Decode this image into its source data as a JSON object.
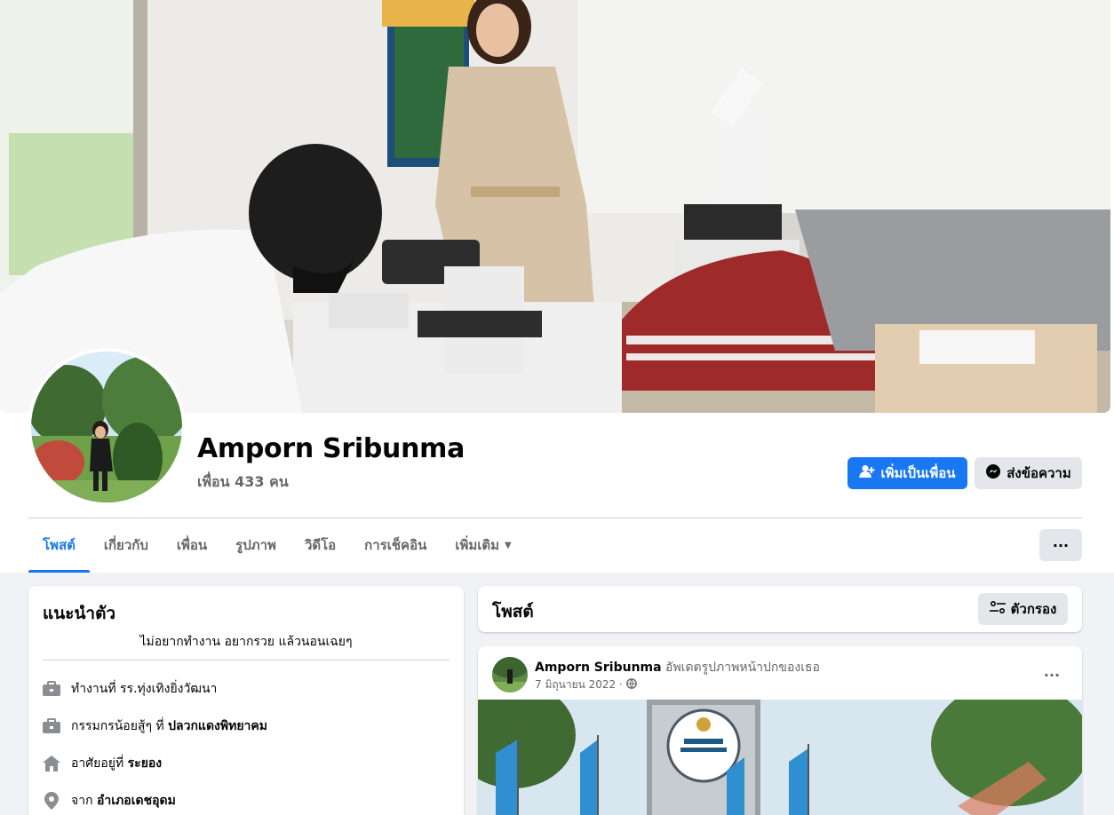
{
  "profile": {
    "name": "Amporn Sribunma",
    "friends": "เพื่อน 433 คน"
  },
  "actions": {
    "add_friend": "เพิ่มเป็นเพื่อน",
    "message": "ส่งข้อความ",
    "more": "···"
  },
  "tabs": [
    {
      "label": "โพสต์",
      "active": true
    },
    {
      "label": "เกี่ยวกับ"
    },
    {
      "label": "เพื่อน"
    },
    {
      "label": "รูปภาพ"
    },
    {
      "label": "วิดีโอ"
    },
    {
      "label": "การเช็คอิน"
    },
    {
      "label": "เพิ่มเติม"
    }
  ],
  "intro": {
    "title": "แนะนำตัว",
    "bio": "ไม่อยากทำงาน อยากรวย แล้วนอนเฉยๆ",
    "rows": [
      {
        "icon": "briefcase-icon",
        "prefix": "ทำงานที่ รร.ทุ่งเทิงยิ่งวัฒนา",
        "bold": ""
      },
      {
        "icon": "briefcase-icon",
        "prefix": "กรรมกรน้อยสู้ๆ ที่ ",
        "bold": "ปลวกแดงพิทยาคม"
      },
      {
        "icon": "home-icon",
        "prefix": "อาศัยอยู่ที่ ",
        "bold": "ระยอง"
      },
      {
        "icon": "location-pin-icon",
        "prefix": "จาก ",
        "bold": "อำเภอเดชอุดม"
      }
    ]
  },
  "posts": {
    "title": "โพสต์",
    "filter_label": "ตัวกรอง",
    "items": [
      {
        "author": "Amporn Sribunma",
        "action": " อัพเดตรูปภาพหน้าปกของเธอ",
        "date": "7 มิถุนายน 2022 ·",
        "more": "···"
      }
    ]
  },
  "colors": {
    "accent": "#1877f2",
    "page_bg": "#f0f2f5",
    "secondary_button": "#e4e6eb"
  }
}
